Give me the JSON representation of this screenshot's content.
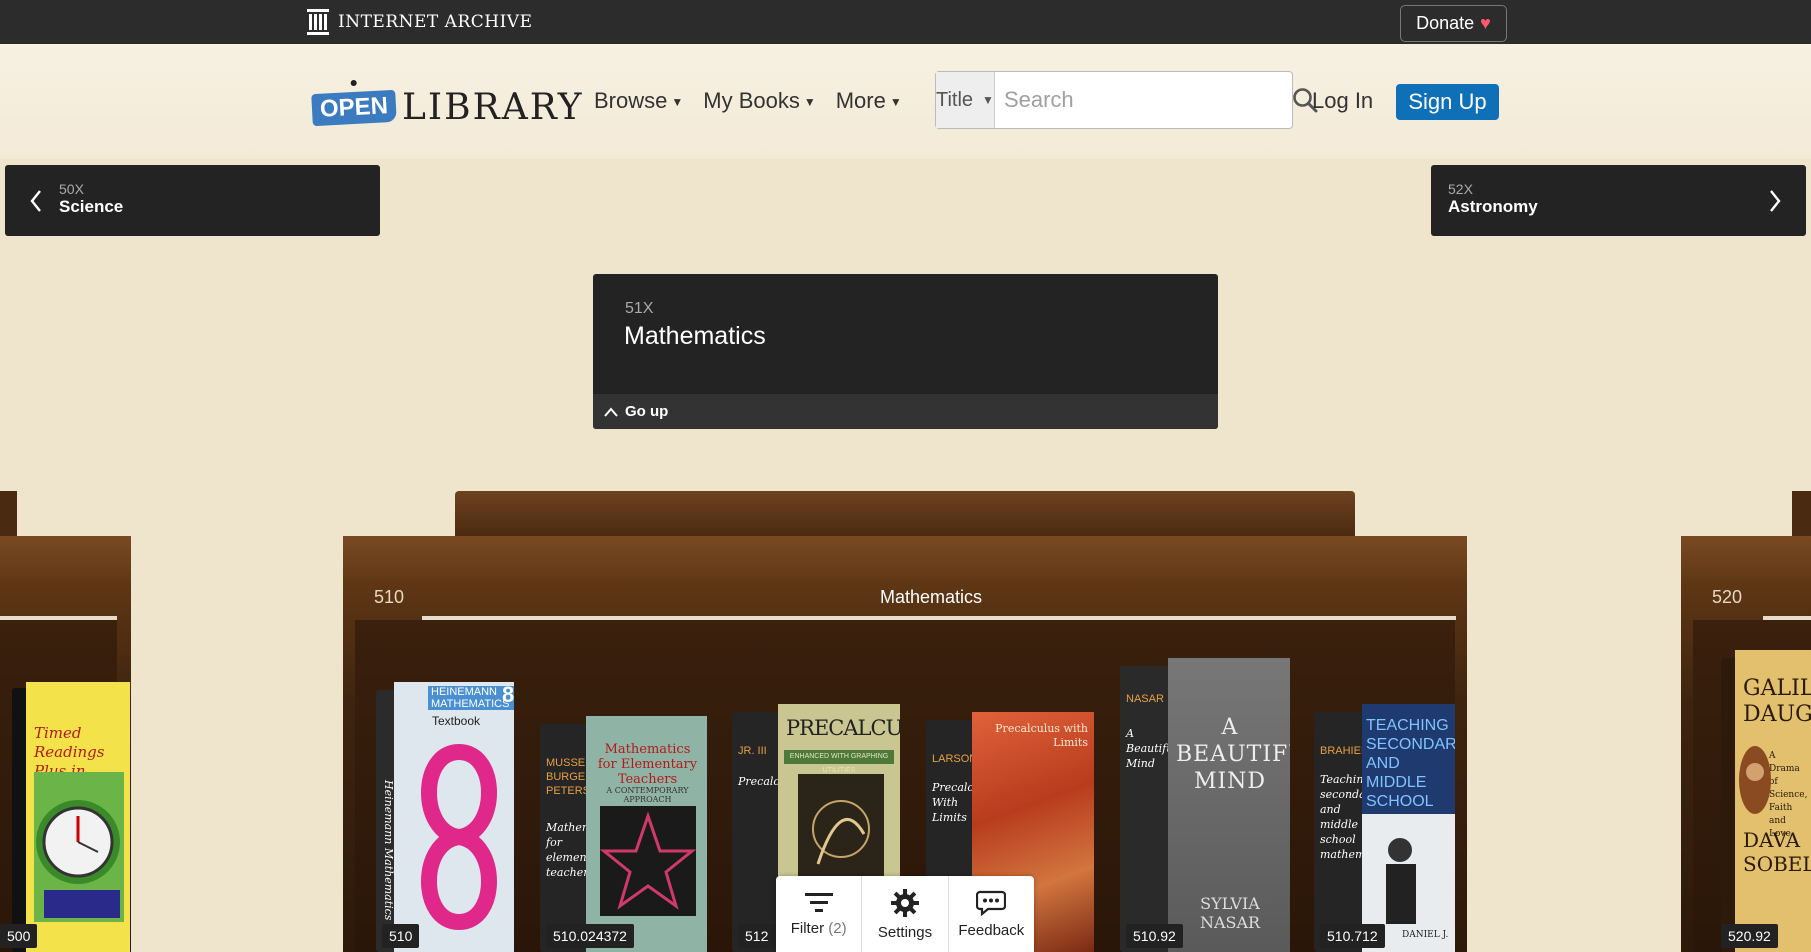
{
  "ia": {
    "brand": "INTERNET ARCHIVE",
    "donate_label": "Donate",
    "donate_heart": "♥"
  },
  "header": {
    "logo_open": "OPEN",
    "logo_library": "LIBRARY",
    "nav": [
      {
        "label": "Browse",
        "icon": "chevron-down-icon"
      },
      {
        "label": "My Books",
        "icon": "chevron-down-icon"
      },
      {
        "label": "More",
        "icon": "chevron-down-icon"
      }
    ],
    "search": {
      "type_label": "Title",
      "placeholder": "Search",
      "icon": "search-icon"
    },
    "login_label": "Log In",
    "signup_label": "Sign Up"
  },
  "classes": {
    "prev": {
      "code": "50X",
      "name": "Science"
    },
    "next": {
      "code": "52X",
      "name": "Astronomy"
    },
    "current": {
      "code": "51X",
      "name": "Mathematics",
      "go_up": "Go up"
    }
  },
  "shelves": {
    "left": {
      "code": "500"
    },
    "center": {
      "code": "510",
      "title": "Mathematics"
    },
    "right": {
      "code": "520"
    }
  },
  "books": {
    "left_0": {
      "cover_title": "Timed Readings Plus in Science",
      "call": "500"
    },
    "b1": {
      "publisher": "HEINEMANN MATHEMATICS",
      "badge": "8",
      "subtitle": "Textbook",
      "spine": "Heinemann Mathematics",
      "call": "510"
    },
    "b2": {
      "author": "MUSSER BURGER PETERSON",
      "spine": "Mathematics for elementary teachers",
      "cover_title": "Mathematics for Elementary Teachers",
      "cover_sub": "A CONTEMPORARY APPROACH",
      "call": "510.024372"
    },
    "b3": {
      "author": "JR. III",
      "spine": "Precalculus",
      "cover_title": "PRECALCULUS",
      "cover_sub": "ENHANCED WITH GRAPHING UTILITIES",
      "call": "512"
    },
    "b4": {
      "author": "LARSON",
      "spine": "Precalculus With Limits",
      "cover_title": "Precalculus with Limits",
      "call": ""
    },
    "b5": {
      "author": "NASAR",
      "spine": "A Beautiful Mind",
      "cover_title": "A BEAUTIFUL MIND",
      "cover_author": "SYLVIA NASAR",
      "call": "510.92"
    },
    "b6": {
      "author": "BRAHIER",
      "spine": "Teaching secondary and middle school mathematics",
      "cover_title": "TEACHING SECONDARY AND MIDDLE SCHOOL MATHEMATICS",
      "cover_author": "DANIEL J.",
      "call": "510.712"
    },
    "right_0": {
      "cover_title": "GALILEO'S DAUGHTER",
      "cover_sub": "A Drama of Science, Faith and Love",
      "cover_author": "DAVA SOBEL",
      "call": "520.92"
    }
  },
  "toolbar": {
    "filter_label": "Filter",
    "filter_count": "(2)",
    "settings_label": "Settings",
    "feedback_label": "Feedback"
  }
}
